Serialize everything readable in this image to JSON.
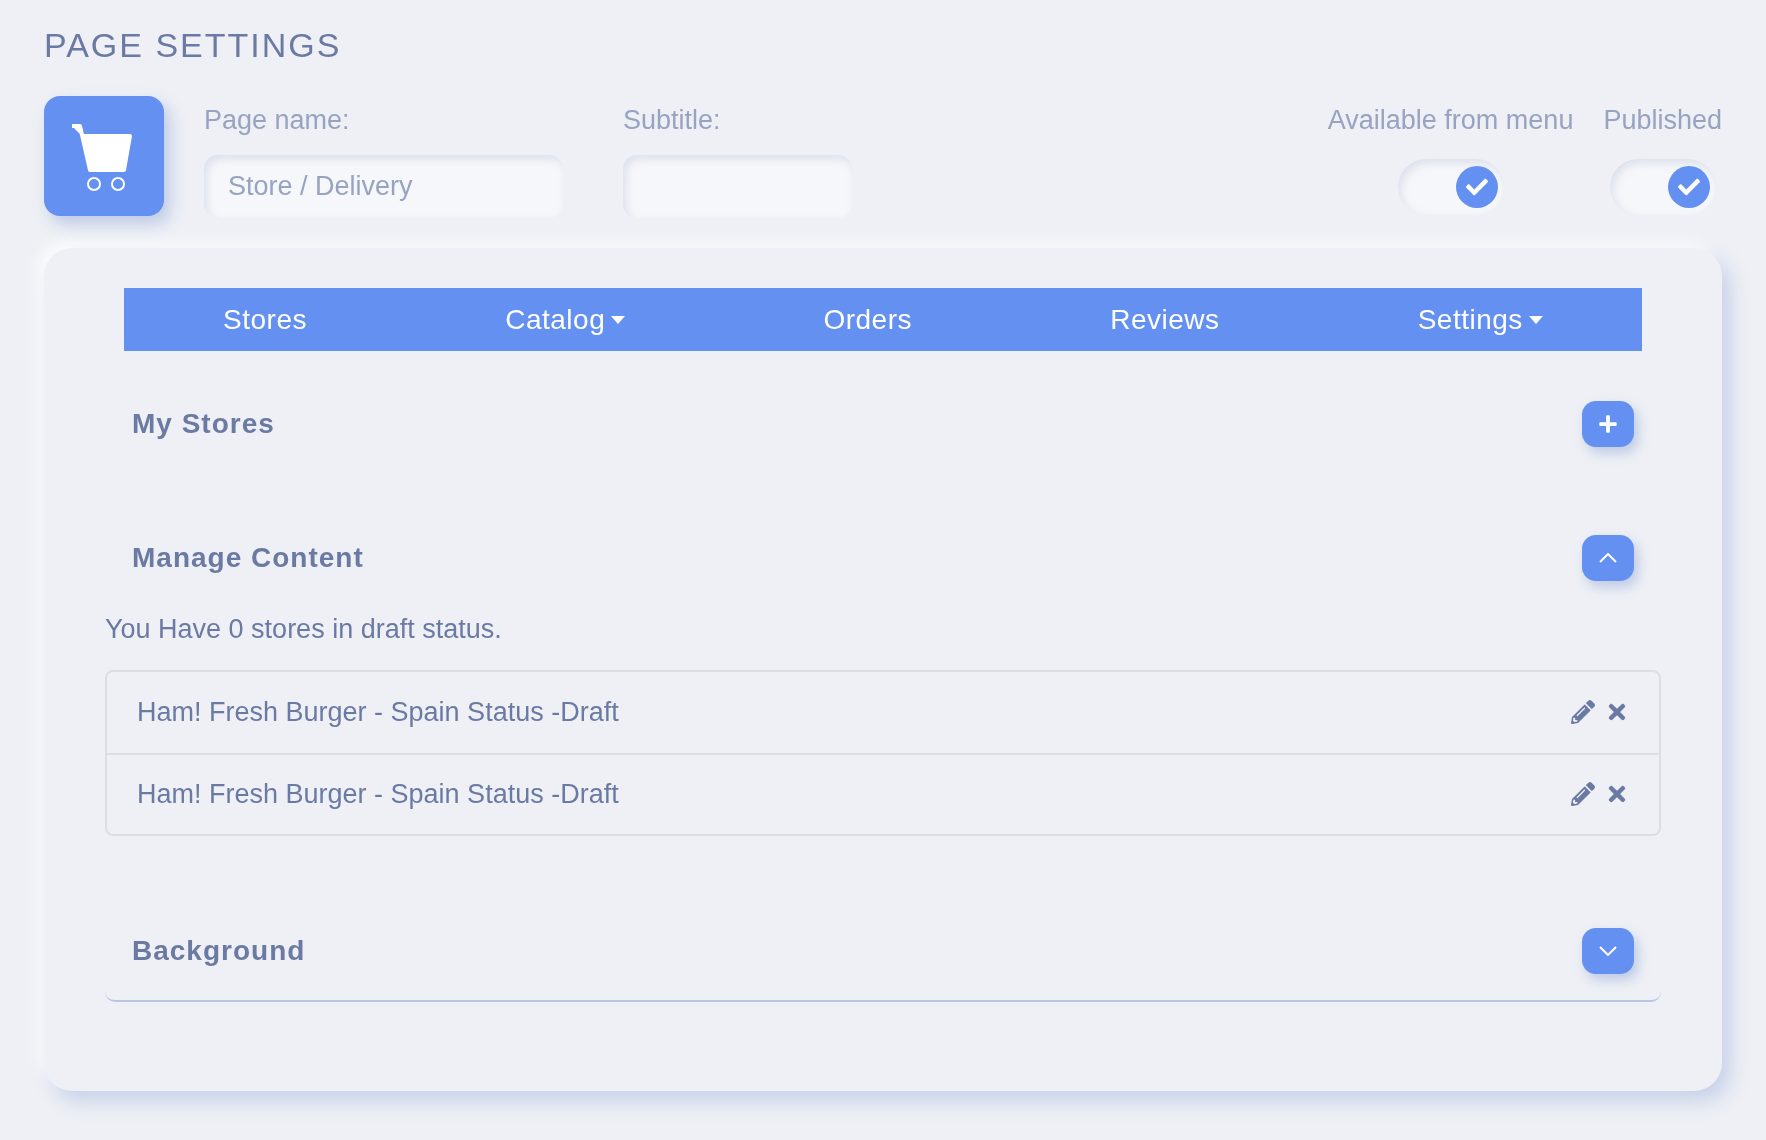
{
  "title": "PAGE SETTINGS",
  "fields": [
    {
      "label": "Page name:",
      "value": "Store / Delivery"
    },
    {
      "label": "Subtitle:"
    }
  ],
  "toggles": [
    {
      "label": "Available from menu",
      "on": true
    },
    {
      "label": "Published",
      "on": true
    }
  ],
  "nav": [
    {
      "label": "Stores",
      "dropdown": false
    },
    {
      "label": "Catalog",
      "dropdown": true
    },
    {
      "label": "Orders",
      "dropdown": false
    },
    {
      "label": "Reviews",
      "dropdown": false
    },
    {
      "label": "Settings",
      "dropdown": true
    }
  ],
  "sections": [
    {
      "title": "My Stores",
      "kind": "add"
    },
    {
      "title": "Manage Content",
      "kind": "toggle",
      "expanded": true,
      "note": "You Have 0 stores in draft status.",
      "items": [
        "Ham! Fresh Burger - Spain Status -Draft",
        "Ham! Fresh Burger - Spain Status -Draft"
      ]
    },
    {
      "title": "Background",
      "kind": "toggle",
      "expanded": false
    }
  ]
}
